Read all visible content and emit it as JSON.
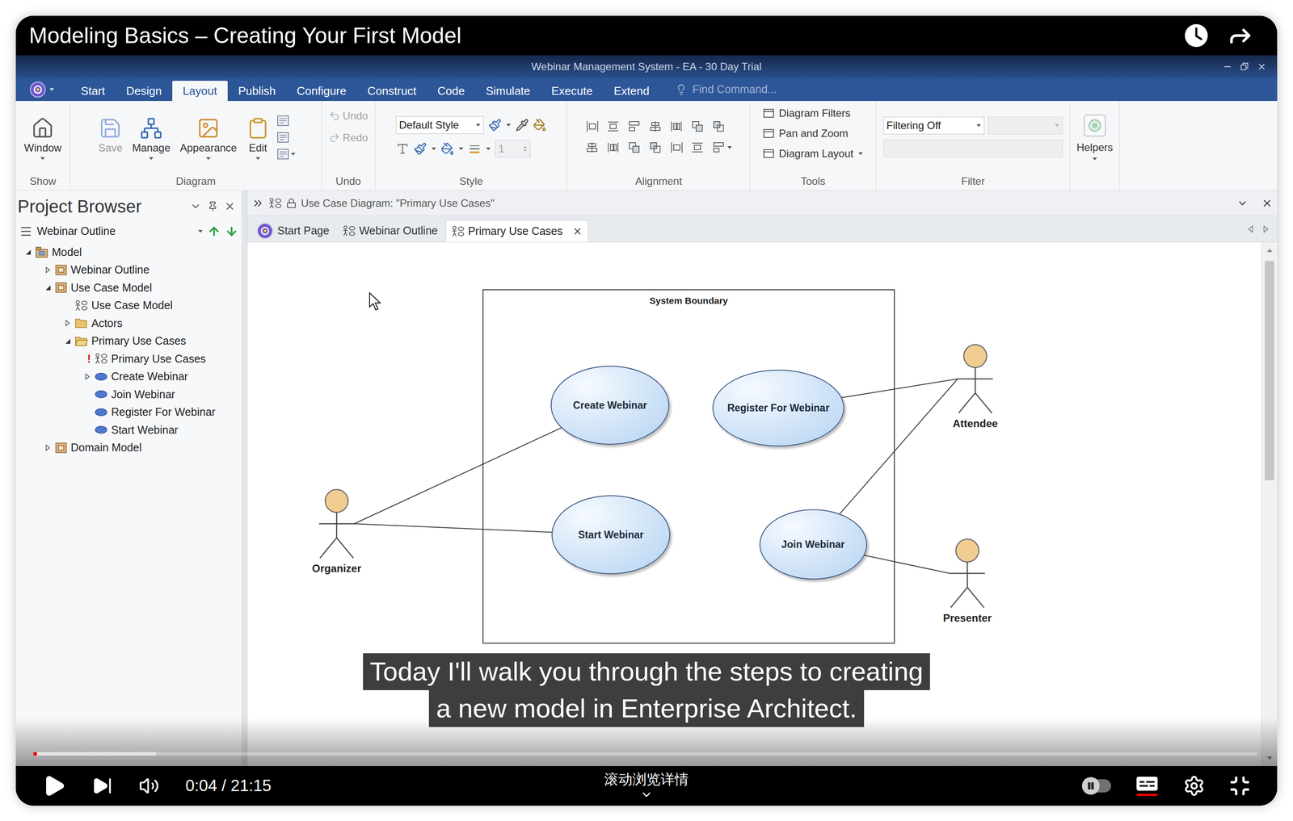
{
  "video": {
    "title": "Modeling Basics – Creating Your First Model",
    "playing": false,
    "time": "0:04 / 21:15",
    "progress": {
      "level": 0.003,
      "buffered": 0.1
    },
    "captions": [
      "Today I'll walk you through the steps to creating",
      "a new model in Enterprise Architect."
    ],
    "details_label": "滚动浏览详情",
    "autoplay": false,
    "subtitles": true
  },
  "window": {
    "title": "Webinar Management System - EA - 30 Day Trial"
  },
  "ribbon_tabs": [
    {
      "label": "Start",
      "selected": false
    },
    {
      "label": "Design",
      "selected": false
    },
    {
      "label": "Layout",
      "selected": true
    },
    {
      "label": "Publish",
      "selected": false
    },
    {
      "label": "Configure",
      "selected": false
    },
    {
      "label": "Construct",
      "selected": false
    },
    {
      "label": "Code",
      "selected": false
    },
    {
      "label": "Simulate",
      "selected": false
    },
    {
      "label": "Execute",
      "selected": false
    },
    {
      "label": "Extend",
      "selected": false
    }
  ],
  "find_command": {
    "placeholder": "Find Command..."
  },
  "ribbon": {
    "show": {
      "label": "Show",
      "buttons": [
        {
          "label": "Window",
          "disabled": false,
          "dropdown": true
        }
      ]
    },
    "diagram": {
      "label": "Diagram",
      "buttons": [
        {
          "label": "Save",
          "disabled": true,
          "dropdown": false
        },
        {
          "label": "Manage",
          "disabled": false,
          "dropdown": true
        },
        {
          "label": "Appearance",
          "disabled": false,
          "dropdown": true
        },
        {
          "label": "Edit",
          "disabled": false,
          "dropdown": true
        }
      ]
    },
    "undo": {
      "label": "Undo",
      "buttons": [
        {
          "label": "Undo",
          "disabled": true
        },
        {
          "label": "Redo",
          "disabled": true
        }
      ]
    },
    "style": {
      "label": "Style",
      "style_select": {
        "value": "Default Style"
      },
      "line_width": {
        "value": "1",
        "disabled": true
      }
    },
    "alignment": {
      "label": "Alignment"
    },
    "tools": {
      "label": "Tools",
      "buttons": [
        {
          "label": "Diagram Filters",
          "dropdown": false
        },
        {
          "label": "Pan and Zoom",
          "dropdown": false
        },
        {
          "label": "Diagram Layout",
          "dropdown": true
        }
      ]
    },
    "filter": {
      "label": "Filter",
      "select": {
        "value": "Filtering Off",
        "disabled": false
      },
      "second_select": {
        "disabled": true
      },
      "field": {
        "disabled": true
      }
    },
    "helpers": {
      "label": "Helpers",
      "dropdown": true
    }
  },
  "project_browser": {
    "title": "Project Browser",
    "toolbar": {
      "label": "Webinar Outline"
    },
    "items": [
      {
        "label": "Model",
        "depth": 0,
        "kind": "model",
        "expandable": true,
        "expanded": true
      },
      {
        "label": "Webinar Outline",
        "depth": 1,
        "kind": "package",
        "expandable": true,
        "expanded": false
      },
      {
        "label": "Use Case Model",
        "depth": 1,
        "kind": "package",
        "expandable": true,
        "expanded": true
      },
      {
        "label": "Use Case Model",
        "depth": 2,
        "kind": "diagram",
        "expandable": false,
        "expanded": false
      },
      {
        "label": "Actors",
        "depth": 2,
        "kind": "folder",
        "expandable": true,
        "expanded": false
      },
      {
        "label": "Primary Use Cases",
        "depth": 2,
        "kind": "folder",
        "expandable": true,
        "expanded": true
      },
      {
        "label": "Primary Use Cases",
        "depth": 3,
        "kind": "diagram",
        "expandable": false,
        "expanded": false,
        "marker": "!"
      },
      {
        "label": "Create Webinar",
        "depth": 3,
        "kind": "usecase",
        "expandable": true,
        "expanded": false
      },
      {
        "label": "Join Webinar",
        "depth": 3,
        "kind": "usecase",
        "expandable": false,
        "expanded": false
      },
      {
        "label": "Register For Webinar",
        "depth": 3,
        "kind": "usecase",
        "expandable": false,
        "expanded": false
      },
      {
        "label": "Start Webinar",
        "depth": 3,
        "kind": "usecase",
        "expandable": false,
        "expanded": false
      },
      {
        "label": "Domain Model",
        "depth": 1,
        "kind": "package",
        "expandable": true,
        "expanded": false
      }
    ]
  },
  "diagram_view": {
    "header": "Use Case Diagram: \"Primary Use Cases\"",
    "locked": true,
    "tabs": [
      {
        "label": "Start Page",
        "kind": "start",
        "selected": false,
        "closable": false
      },
      {
        "label": "Webinar Outline",
        "kind": "diagram",
        "selected": false,
        "closable": false
      },
      {
        "label": "Primary Use Cases",
        "kind": "diagram",
        "selected": true,
        "closable": true
      }
    ],
    "diagram": {
      "boundary": "System Boundary",
      "use_cases": [
        {
          "name": "Create Webinar"
        },
        {
          "name": "Register For Webinar"
        },
        {
          "name": "Start Webinar"
        },
        {
          "name": "Join Webinar"
        }
      ],
      "actors": [
        {
          "name": "Organizer"
        },
        {
          "name": "Attendee"
        },
        {
          "name": "Presenter"
        }
      ],
      "associations": [
        {
          "actor": "Organizer",
          "use_case": "Create Webinar"
        },
        {
          "actor": "Organizer",
          "use_case": "Start Webinar"
        },
        {
          "actor": "Attendee",
          "use_case": "Register For Webinar"
        },
        {
          "actor": "Attendee",
          "use_case": "Join Webinar"
        },
        {
          "actor": "Presenter",
          "use_case": "Join Webinar"
        }
      ]
    }
  }
}
